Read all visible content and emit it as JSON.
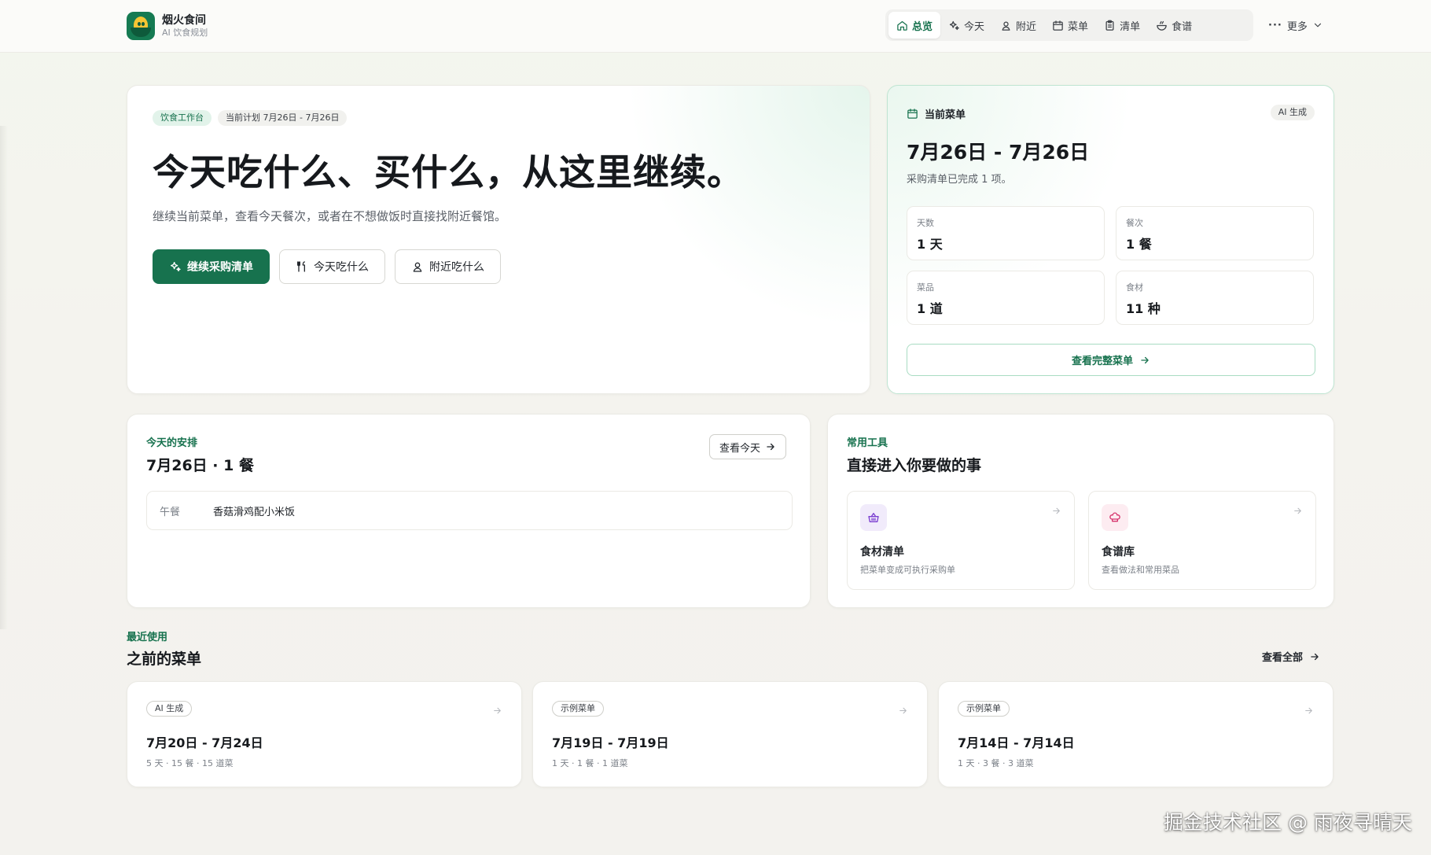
{
  "brand": {
    "name": "烟火食间",
    "subtitle": "AI 饮食规划"
  },
  "nav": {
    "items": [
      {
        "label": "总览",
        "icon": "home-icon",
        "active": true
      },
      {
        "label": "今天",
        "icon": "sparkles-icon"
      },
      {
        "label": "附近",
        "icon": "location-person-icon"
      },
      {
        "label": "菜单",
        "icon": "calendar-icon"
      },
      {
        "label": "清单",
        "icon": "clipboard-icon"
      },
      {
        "label": "食谱",
        "icon": "bowl-icon"
      }
    ],
    "more": "更多"
  },
  "hero": {
    "tag": "饮食工作台",
    "plan": "当前计划 7月26日 - 7月26日",
    "title": "今天吃什么、买什么，从这里继续。",
    "description": "继续当前菜单，查看今天餐次，或者在不想做饭时直接找附近餐馆。",
    "buttons": {
      "primary": "继续采购清单",
      "today": "今天吃什么",
      "nearby": "附近吃什么"
    }
  },
  "current_menu": {
    "heading": "当前菜单",
    "badge": "AI 生成",
    "range": "7月26日 - 7月26日",
    "status": "采购清单已完成 1 项。",
    "stats": [
      {
        "label": "天数",
        "value": "1 天"
      },
      {
        "label": "餐次",
        "value": "1 餐"
      },
      {
        "label": "菜品",
        "value": "1 道"
      },
      {
        "label": "食材",
        "value": "11 种"
      }
    ],
    "link": "查看完整菜单"
  },
  "today": {
    "eyebrow": "今天的安排",
    "title": "7月26日 · 1 餐",
    "button": "查看今天",
    "meals": [
      {
        "slot": "午餐",
        "dish": "香菇滑鸡配小米饭"
      }
    ]
  },
  "tools": {
    "eyebrow": "常用工具",
    "title": "直接进入你要做的事",
    "items": [
      {
        "title": "食材清单",
        "desc": "把菜单变成可执行采购单",
        "color": "#7b3fd1",
        "bg": "#f1ebfb",
        "icon": "basket-icon"
      },
      {
        "title": "食谱库",
        "desc": "查看做法和常用菜品",
        "color": "#d6336c",
        "bg": "#fdecf1",
        "icon": "chef-hat-icon"
      }
    ]
  },
  "recent": {
    "eyebrow": "最近使用",
    "title": "之前的菜单",
    "view_all": "查看全部",
    "plans": [
      {
        "badge": "AI 生成",
        "range": "7月20日 - 7月24日",
        "meta": "5 天 · 15 餐 · 15 道菜"
      },
      {
        "badge": "示例菜单",
        "range": "7月19日 - 7月19日",
        "meta": "1 天 · 1 餐 · 1 道菜"
      },
      {
        "badge": "示例菜单",
        "range": "7月14日 - 7月14日",
        "meta": "1 天 · 3 餐 · 3 道菜"
      }
    ]
  },
  "watermark": "掘金技术社区 @ 雨夜寻晴天",
  "colors": {
    "primary": "#17724e",
    "primary_light": "#e2f3ea",
    "border": "#ebeae5"
  }
}
